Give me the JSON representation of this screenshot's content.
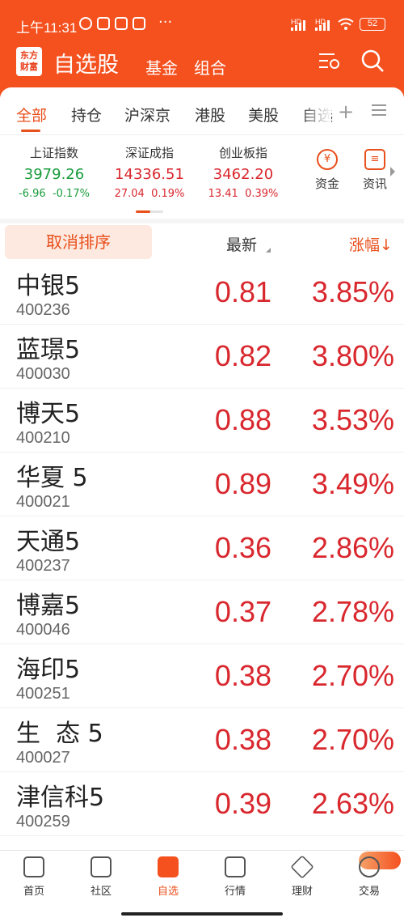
{
  "status": {
    "time": "上午11:31",
    "battery": "52"
  },
  "header": {
    "logo_text": "东方财富",
    "title": "自选股",
    "links": [
      "基金",
      "组合"
    ]
  },
  "tabs": [
    "全部",
    "持仓",
    "沪深京",
    "港股",
    "美股",
    "自选"
  ],
  "indices": [
    {
      "name": "上证指数",
      "value": "3979.26",
      "change": "-6.96",
      "pct": "-0.17%",
      "color": "#1a9c3c"
    },
    {
      "name": "深证成指",
      "value": "14336.51",
      "change": "27.04",
      "pct": "0.19%",
      "color": "#d9272e"
    },
    {
      "name": "创业板指",
      "value": "3462.20",
      "change": "13.41",
      "pct": "0.39%",
      "color": "#d9272e"
    }
  ],
  "quick": [
    {
      "label": "资金",
      "icon": "yuan-circle-icon",
      "glyph": "¥"
    },
    {
      "label": "资讯",
      "icon": "document-icon",
      "glyph": "≡"
    }
  ],
  "sort_bar": {
    "cancel": "取消排序",
    "latest": "最新",
    "change": "涨幅↓"
  },
  "rows": [
    {
      "name": "中银5",
      "code": "400236",
      "latest": "0.81",
      "change": "3.85%"
    },
    {
      "name": "蓝璟5",
      "code": "400030",
      "latest": "0.82",
      "change": "3.80%"
    },
    {
      "name": "博天5",
      "code": "400210",
      "latest": "0.88",
      "change": "3.53%"
    },
    {
      "name": "华夏 5",
      "code": "400021",
      "latest": "0.89",
      "change": "3.49%"
    },
    {
      "name": "天通5",
      "code": "400237",
      "latest": "0.36",
      "change": "2.86%"
    },
    {
      "name": "博嘉5",
      "code": "400046",
      "latest": "0.37",
      "change": "2.78%"
    },
    {
      "name": "海印5",
      "code": "400251",
      "latest": "0.38",
      "change": "2.70%"
    },
    {
      "name": "生  态 5",
      "code": "400027",
      "latest": "0.38",
      "change": "2.70%"
    },
    {
      "name": "津信科5",
      "code": "400259",
      "latest": "0.39",
      "change": "2.63%"
    }
  ],
  "bottom_nav": [
    {
      "label": "首页",
      "icon": "home-icon",
      "active": false
    },
    {
      "label": "社区",
      "icon": "community-icon",
      "active": false
    },
    {
      "label": "自选",
      "icon": "watchlist-icon",
      "active": true
    },
    {
      "label": "行情",
      "icon": "market-chart-icon",
      "active": false
    },
    {
      "label": "理财",
      "icon": "wealth-icon",
      "active": false
    },
    {
      "label": "交易",
      "icon": "trade-icon",
      "active": false
    }
  ],
  "colors": {
    "brand": "#f5511f",
    "up": "#d9272e",
    "down": "#1a9c3c",
    "accent": "#e8501c"
  }
}
